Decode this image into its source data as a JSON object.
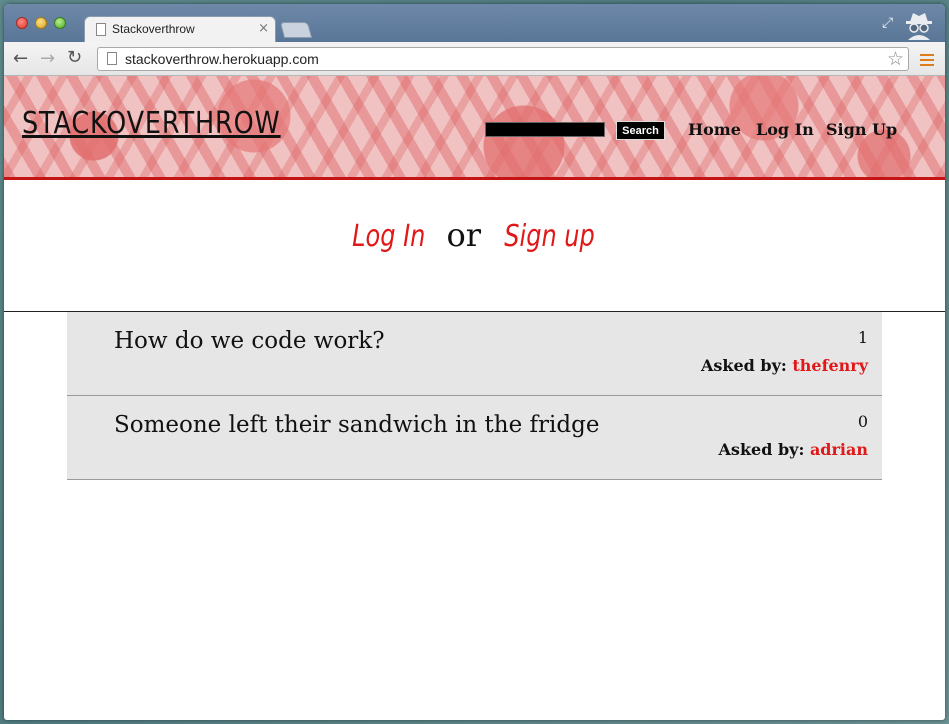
{
  "browser": {
    "tab_title": "Stackoverthrow",
    "tab_close": "×",
    "url": "stackoverthrow.herokuapp.com",
    "back": "←",
    "forward": "→",
    "reload": "↻",
    "star": "☆",
    "resize": "⤢"
  },
  "header": {
    "brand": "STACKOVERTHROW",
    "search_button": "Search",
    "search_value": "",
    "nav": [
      {
        "label": "Home"
      },
      {
        "label": "Log In"
      },
      {
        "label": "Sign Up"
      }
    ]
  },
  "auth": {
    "login": "Log In",
    "or": "or",
    "signup": "Sign up"
  },
  "questions": [
    {
      "title": "How do we code work?",
      "count": "1",
      "asked_label": "Asked by:",
      "author": "thefenry"
    },
    {
      "title": "Someone left their sandwich in the fridge",
      "count": "0",
      "asked_label": "Asked by:",
      "author": "adrian"
    }
  ],
  "colors": {
    "accent": "#e01818",
    "row_bg": "#e6e6e6",
    "header_border": "#c41414"
  },
  "icons": {
    "tab_page": "page-icon",
    "incognito": "incognito-icon",
    "menu": "menu-icon"
  }
}
